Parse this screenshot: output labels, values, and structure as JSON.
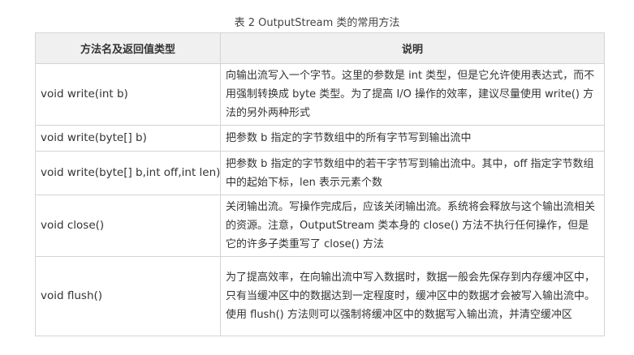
{
  "caption": "表 2 OutputStream 类的常用方法",
  "table": {
    "headers": [
      "方法名及返回值类型",
      "说明"
    ],
    "rows": [
      {
        "method": "void write(int b)",
        "description": "向输出流写入一个字节。这里的参数是 int 类型，但是它允许使用表达式，而不用强制转换成 byte 类型。为了提高 I/O 操作的效率，建议尽量使用 write() 方法的另外两种形式"
      },
      {
        "method": "void write(byte[] b)",
        "description": "把参数 b 指定的字节数组中的所有字节写到输出流中"
      },
      {
        "method": "void write(byte[] b,int off,int len)",
        "description": "把参数 b 指定的字节数组中的若干字节写到输出流中。其中，off 指定字节数组中的起始下标，len 表示元素个数"
      },
      {
        "method": "void close()",
        "description": "关闭输出流。写操作完成后，应该关闭输出流。系统将会释放与这个输出流相关的资源。注意，OutputStream 类本身的 close() 方法不执行任何操作，但是它的许多子类重写了 close() 方法"
      },
      {
        "method": "void flush()",
        "description": "为了提高效率，在向输出流中写入数据时，数据一般会先保存到内存缓冲区中，只有当缓冲区中的数据达到一定程度时，缓冲区中的数据才会被写入输出流中。使用 flush() 方法则可以强制将缓冲区中的数据写入输出流，并清空缓冲区"
      }
    ]
  }
}
